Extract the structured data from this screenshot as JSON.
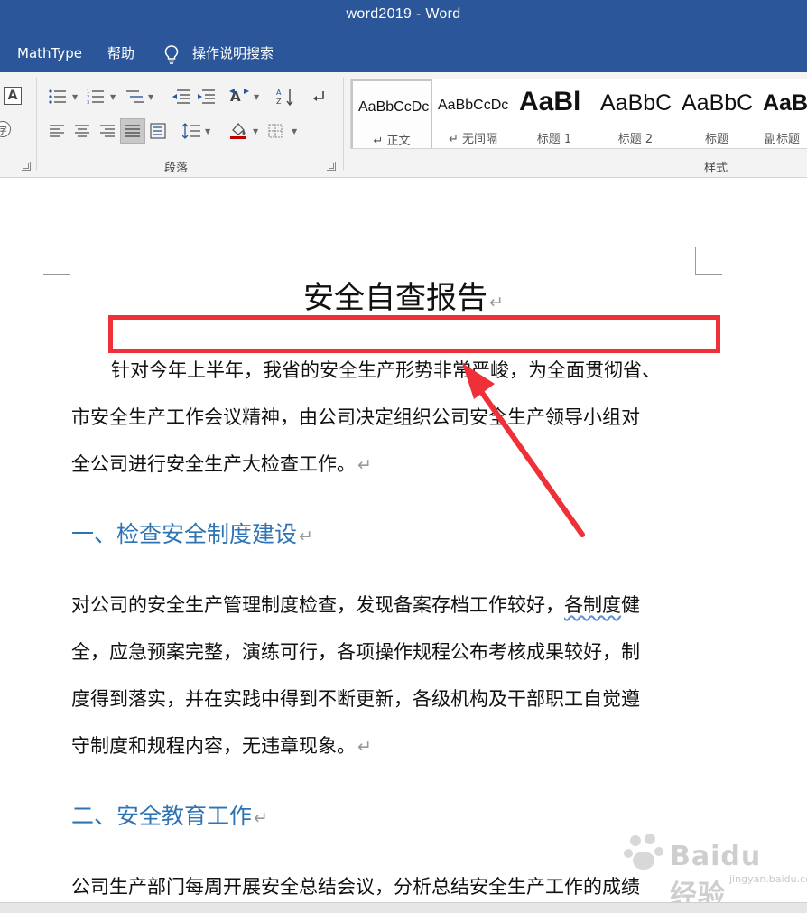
{
  "window": {
    "title": "word2019  -  Word"
  },
  "menu": {
    "items": [
      "MathType",
      "帮助"
    ],
    "tell_me": "操作说明搜索"
  },
  "ribbon": {
    "paragraph_group_label": "段落",
    "styles_group_label": "样式",
    "styles": [
      {
        "sample": "AaBbCcDc",
        "name": "↵ 正文",
        "selected": true
      },
      {
        "sample": "AaBbCcDc",
        "name": "↵ 无间隔",
        "selected": false
      },
      {
        "sample": "AaBl",
        "name": "标题 1",
        "selected": false
      },
      {
        "sample": "AaBbC",
        "name": "标题 2",
        "selected": false
      },
      {
        "sample": "AaBbC",
        "name": "标题",
        "selected": false
      },
      {
        "sample": "AaB",
        "name": "副标题",
        "selected": false
      }
    ]
  },
  "document": {
    "title": "安全自查报告",
    "paragraph1": [
      "针对今年上半年，我省的安全生产形势非常严峻，为全面贯彻省、",
      "市安全生产工作会议精神，由公司决定组织公司安全生产领导小组对",
      "全公司进行安全生产大检查工作。"
    ],
    "heading1": "一、检查安全制度建设",
    "paragraph2": [
      "对公司的安全生产管理制度检查，发现备案存档工作较好，",
      "各制度",
      "健",
      "全，应急预案完整，演练可行，各项操作规程公布考核成果较好，制",
      "度得到落实，并在实践中得到不断更新，各级机构及干部职工自觉遵",
      "守制度和规程内容，无违章现象。"
    ],
    "heading2": "二、安全教育工作",
    "paragraph3": [
      "公司生产部门每周开展安全总结会议，分析总结安全生产工作的成绩"
    ],
    "paragraph_mark": "↵"
  },
  "annotation": {
    "box_color": "#ef3038",
    "arrow_color": "#ef3038"
  },
  "watermark": {
    "text": "Baidu经验",
    "sub": "jingyan.baidu.com"
  },
  "colors": {
    "title_bar": "#2b579a",
    "heading": "#2e74b5"
  }
}
